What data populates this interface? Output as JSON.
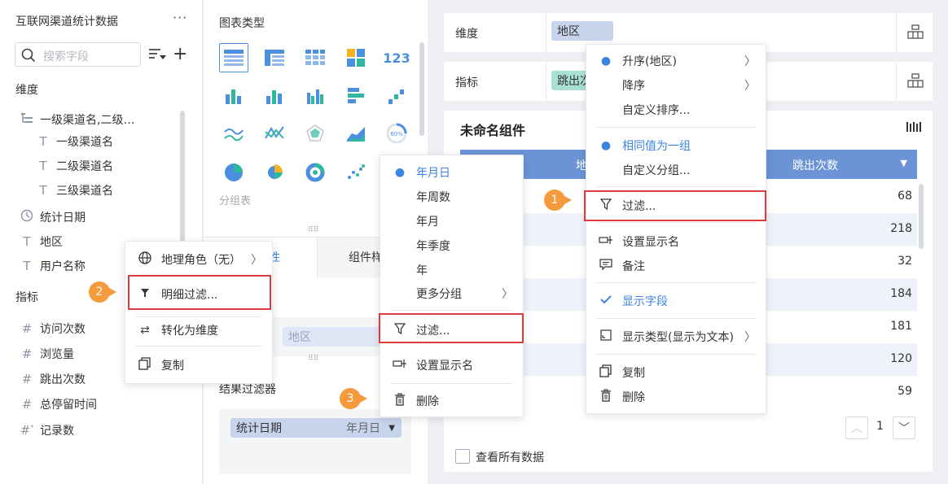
{
  "left": {
    "title": "互联网渠道统计数据",
    "more": "···",
    "search_placeholder": "搜索字段",
    "dim_label": "维度",
    "dims": [
      {
        "label": "一级渠道名,二级…",
        "icon": "tree-icon"
      },
      {
        "label": "一级渠道名",
        "icon": "text-field-icon"
      },
      {
        "label": "二级渠道名",
        "icon": "text-field-icon"
      },
      {
        "label": "三级渠道名",
        "icon": "text-field-icon"
      },
      {
        "label": "统计日期",
        "icon": "clock-icon"
      },
      {
        "label": "地区",
        "icon": "text-field-icon"
      },
      {
        "label": "用户名称",
        "icon": "text-field-icon"
      }
    ],
    "metric_label": "指标",
    "metrics": [
      {
        "label": "访问次数"
      },
      {
        "label": "浏览量"
      },
      {
        "label": "跳出次数"
      },
      {
        "label": "总停留时间"
      },
      {
        "label": "记录数"
      }
    ]
  },
  "mid": {
    "chart_type_title": "图表类型",
    "group_label": "分组表",
    "tab_attr": "性",
    "tab_style": "组件样",
    "region_pill": "地区",
    "result_filter_title": "结果过滤器",
    "filter_pill_label": "统计日期",
    "filter_pill_value": "年月日"
  },
  "right": {
    "dim_row_label": "维度",
    "dim_pill": "地区",
    "metric_row_label": "指标",
    "metric_pill": "跳出次",
    "widget_title": "未命名组件",
    "col_region": "地",
    "col_bounce": "跳出次数",
    "values": [
      "68",
      "218",
      "32",
      "184",
      "181",
      "120",
      "59"
    ],
    "page": "1",
    "view_all": "查看所有数据"
  },
  "menu_field": {
    "items": [
      {
        "label": "地理角色（无）",
        "icon": "globe-icon"
      },
      {
        "label": "明细过滤...",
        "icon": "funnel-filled-icon"
      },
      {
        "label": "转化为维度",
        "icon": "swap-icon"
      },
      {
        "label": "复制",
        "icon": "copy-icon"
      }
    ]
  },
  "menu_date": {
    "items": [
      {
        "label": "年月日",
        "selected": true
      },
      {
        "label": "年周数"
      },
      {
        "label": "年月"
      },
      {
        "label": "年季度"
      },
      {
        "label": "年"
      },
      {
        "label": "更多分组"
      },
      {
        "label": "过滤..."
      },
      {
        "label": "设置显示名"
      },
      {
        "label": "删除"
      }
    ]
  },
  "menu_region": {
    "items": [
      {
        "label": "升序(地区)"
      },
      {
        "label": "降序"
      },
      {
        "label": "自定义排序..."
      },
      {
        "label": "相同值为一组"
      },
      {
        "label": "自定义分组..."
      },
      {
        "label": "过滤..."
      },
      {
        "label": "设置显示名"
      },
      {
        "label": "备注"
      },
      {
        "label": "显示字段"
      },
      {
        "label": "显示类型(显示为文本)"
      },
      {
        "label": "复制"
      },
      {
        "label": "删除"
      }
    ]
  },
  "badges": [
    "1",
    "2",
    "3"
  ],
  "colors": {
    "accent": "#3c84e0",
    "header": "#6b93d6",
    "highlight": "#e0393e",
    "badge": "#f59a3d"
  }
}
